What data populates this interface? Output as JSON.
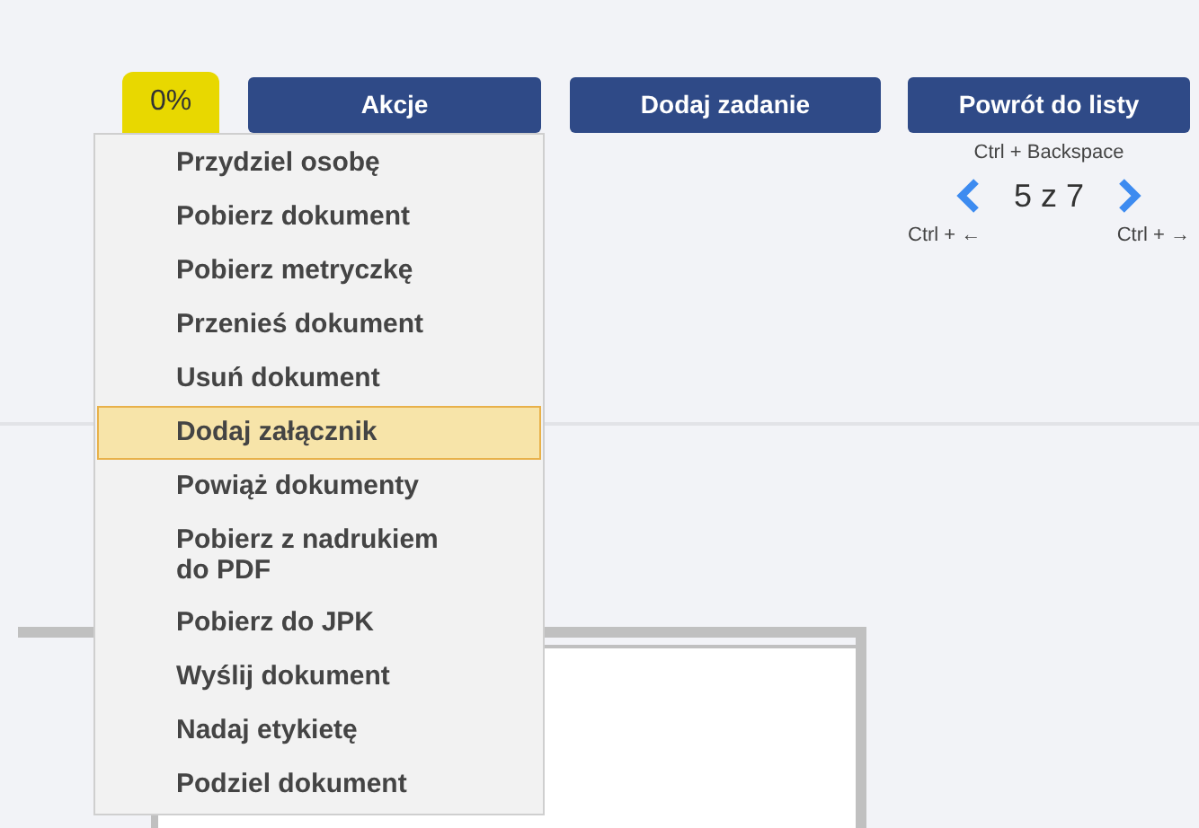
{
  "progress_badge": "0%",
  "buttons": [
    {
      "label": "Akcje"
    },
    {
      "label": "Dodaj zadanie"
    },
    {
      "label": "Powrót do listy"
    }
  ],
  "back_shortcut": "Ctrl + Backspace",
  "pager": {
    "position": "5 z 7",
    "prev_shortcut": "Ctrl + ←",
    "next_shortcut": "Ctrl + →"
  },
  "actions_menu": [
    {
      "label": "Przydziel osobę",
      "selected": false
    },
    {
      "label": "Pobierz dokument",
      "selected": false
    },
    {
      "label": "Pobierz metryczkę",
      "selected": false
    },
    {
      "label": "Przenieś dokument",
      "selected": false
    },
    {
      "label": "Usuń dokument",
      "selected": false
    },
    {
      "label": "Dodaj załącznik",
      "selected": true
    },
    {
      "label": "Powiąż dokumenty",
      "selected": false
    },
    {
      "label": "Pobierz z nadrukiem do PDF",
      "selected": false
    },
    {
      "label": "Pobierz do JPK",
      "selected": false
    },
    {
      "label": "Wyślij dokument",
      "selected": false
    },
    {
      "label": "Nadaj etykietę",
      "selected": false
    },
    {
      "label": "Podziel dokument",
      "selected": false
    }
  ]
}
